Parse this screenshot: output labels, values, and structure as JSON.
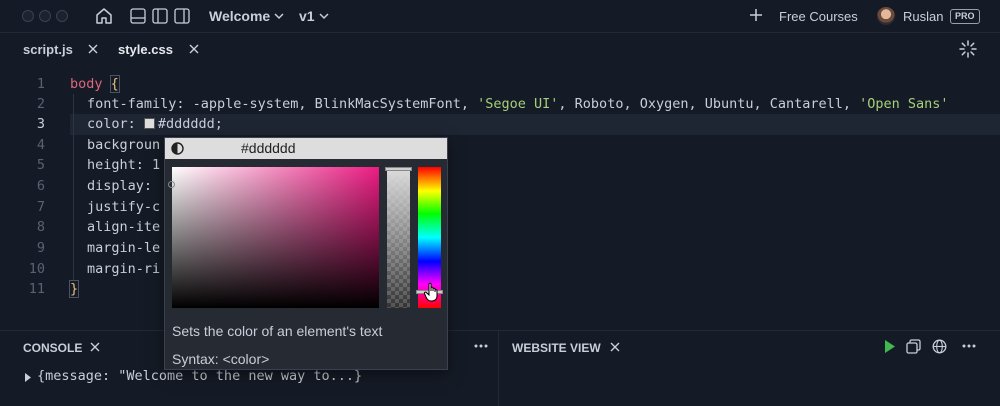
{
  "titlebar": {
    "project_title": "Welcome",
    "version": "v1",
    "free_courses": "Free Courses",
    "user_name": "Ruslan",
    "badge": "PRO"
  },
  "tabs": [
    {
      "label": "script.js",
      "active": false
    },
    {
      "label": "style.css",
      "active": true
    }
  ],
  "editor": {
    "line_numbers": [
      "1",
      "2",
      "3",
      "4",
      "5",
      "6",
      "7",
      "8",
      "9",
      "10",
      "11"
    ],
    "active_line": 3,
    "lines": {
      "l1_selector": "body",
      "l1_brace": "{",
      "l2_prop": "font-family: -apple-system, BlinkMacSystemFont, ",
      "l2_str1": "'Segoe UI'",
      "l2_mid": ", Roboto, Oxygen, Ubuntu, Cantarell, ",
      "l2_str2": "'Open Sans'",
      "l3_prop": "color: ",
      "l3_value": "#dddddd;",
      "l4": "backgroun",
      "l5": "height: 1",
      "l6": "display: ",
      "l7": "justify-c",
      "l8": "align-ite",
      "l9": "margin-le",
      "l10": "margin-ri",
      "l11_brace": "}"
    }
  },
  "color_picker": {
    "hex": "#dddddd",
    "description": "Sets the color of an element's text",
    "syntax": "Syntax: <color>",
    "colors": {
      "current": "#dddddd",
      "hue": "#ec1c83"
    }
  },
  "console": {
    "title": "CONSOLE",
    "log": "{message: \"Welcome to the new way to...}"
  },
  "website_view": {
    "title": "WEBSITE VIEW"
  },
  "colors": {
    "background": "#151b26",
    "keyword": "#e0667a",
    "string": "#a6cf7a",
    "brace": "#e6c07b",
    "run_green": "#3fb950"
  }
}
